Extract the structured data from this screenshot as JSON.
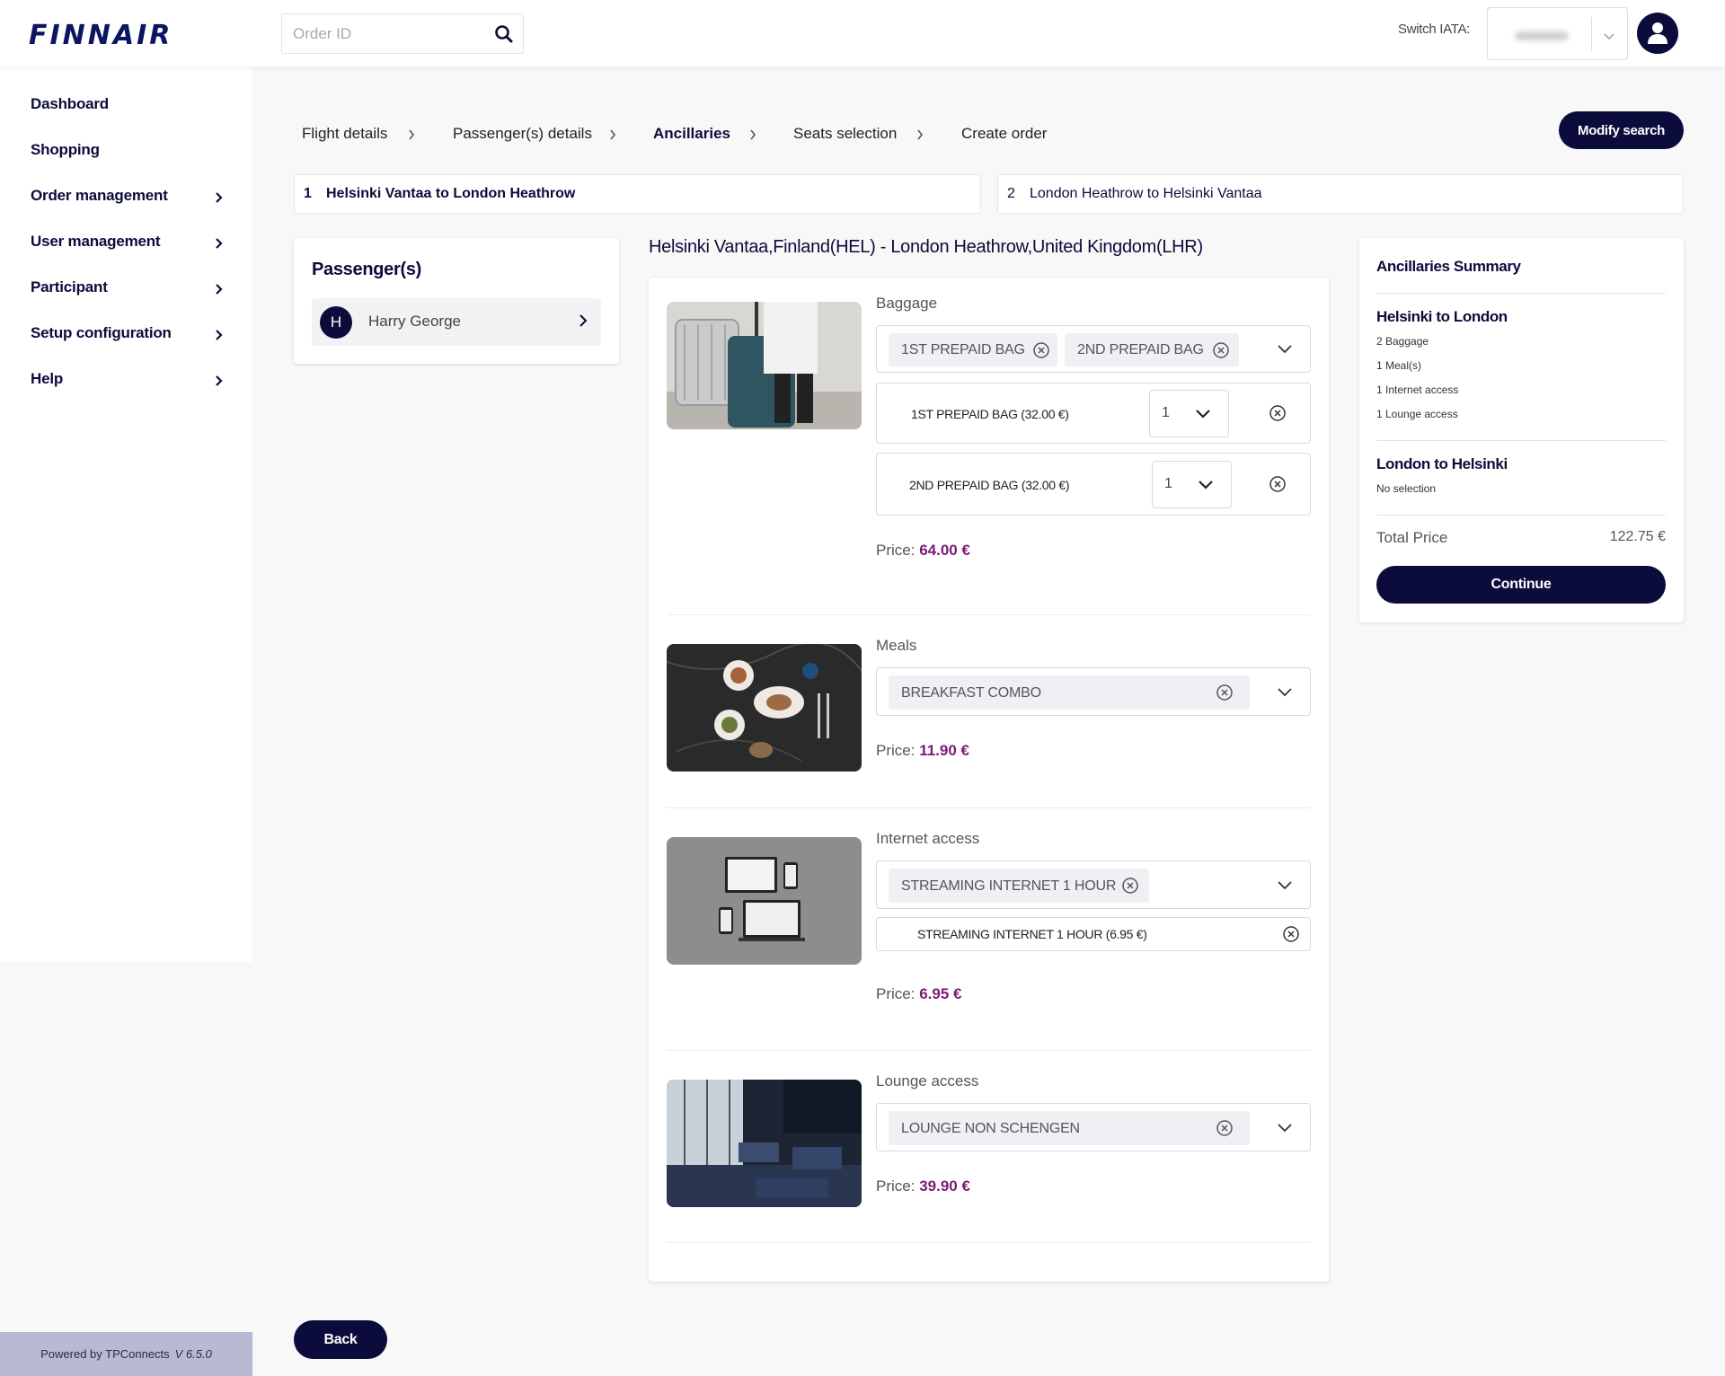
{
  "header": {
    "logo": "FINNAIR",
    "search_placeholder": "Order ID",
    "iata_label": "Switch IATA:"
  },
  "sidebar": {
    "items": [
      {
        "label": "Dashboard",
        "has_children": false
      },
      {
        "label": "Shopping",
        "has_children": false
      },
      {
        "label": "Order management",
        "has_children": true
      },
      {
        "label": "User management",
        "has_children": true
      },
      {
        "label": "Participant",
        "has_children": true
      },
      {
        "label": "Setup configuration",
        "has_children": true
      },
      {
        "label": "Help",
        "has_children": true
      }
    ],
    "powered_by": "Powered by TPConnects",
    "version": "V 6.5.0"
  },
  "breadcrumb": {
    "steps": [
      "Flight details",
      "Passenger(s) details",
      "Ancillaries",
      "Seats selection",
      "Create order"
    ],
    "active": "Ancillaries"
  },
  "modify_search": "Modify search",
  "flights": [
    {
      "num": "1",
      "title": "Helsinki Vantaa to London Heathrow",
      "active": true
    },
    {
      "num": "2",
      "title": "London Heathrow to Helsinki Vantaa",
      "active": false
    }
  ],
  "passengers": {
    "title": "Passenger(s)",
    "list": [
      {
        "initial": "H",
        "name": "Harry George"
      }
    ]
  },
  "route_title": "Helsinki Vantaa,Finland(HEL) - London Heathrow,United Kingdom(LHR)",
  "ancillaries": {
    "baggage": {
      "label": "Baggage",
      "chips": [
        "1ST PREPAID BAG",
        "2ND PREPAID BAG"
      ],
      "details": [
        {
          "name": "1ST PREPAID BAG (32.00 €)",
          "qty": "1"
        },
        {
          "name": "2ND PREPAID BAG (32.00 €)",
          "qty": "1"
        }
      ],
      "price_label": "Price:",
      "price": "64.00 €"
    },
    "meals": {
      "label": "Meals",
      "chips": [
        "BREAKFAST COMBO"
      ],
      "price_label": "Price:",
      "price": "11.90 €"
    },
    "internet": {
      "label": "Internet access",
      "chips": [
        "STREAMING INTERNET 1 HOUR"
      ],
      "details": [
        {
          "name": "STREAMING INTERNET 1 HOUR (6.95 €)"
        }
      ],
      "price_label": "Price:",
      "price": "6.95 €"
    },
    "lounge": {
      "label": "Lounge access",
      "chips": [
        "LOUNGE NON SCHENGEN"
      ],
      "price_label": "Price:",
      "price": "39.90 €"
    }
  },
  "summary": {
    "title": "Ancillaries Summary",
    "segments": [
      {
        "title": "Helsinki to London",
        "items": [
          "2 Baggage",
          "1 Meal(s)",
          "1 Internet access",
          "1 Lounge access"
        ]
      },
      {
        "title": "London to Helsinki",
        "items": [
          "No selection"
        ]
      }
    ],
    "total_label": "Total Price",
    "total_value": "122.75 €",
    "continue": "Continue"
  },
  "back": "Back",
  "colors": {
    "navy": "#0c0c3c",
    "price": "#7a1b76",
    "logo": "#0b1560"
  }
}
